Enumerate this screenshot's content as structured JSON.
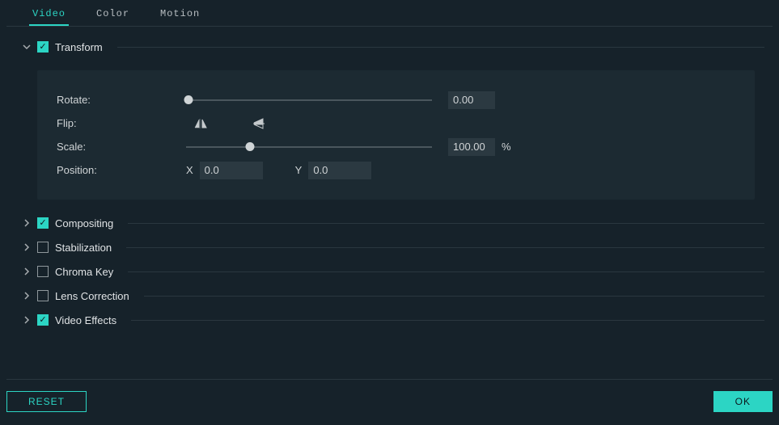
{
  "tabs": {
    "video": "Video",
    "color": "Color",
    "motion": "Motion"
  },
  "sections": {
    "transform": {
      "title": "Transform",
      "checked": true,
      "expanded": true
    },
    "compositing": {
      "title": "Compositing",
      "checked": true,
      "expanded": false
    },
    "stabilization": {
      "title": "Stabilization",
      "checked": false,
      "expanded": false
    },
    "chromakey": {
      "title": "Chroma Key",
      "checked": false,
      "expanded": false
    },
    "lenscorrection": {
      "title": "Lens Correction",
      "checked": false,
      "expanded": false
    },
    "videoeffects": {
      "title": "Video Effects",
      "checked": true,
      "expanded": false
    }
  },
  "transform": {
    "rotate_label": "Rotate:",
    "rotate_value": "0.00",
    "rotate_slider_pct": 1,
    "flip_label": "Flip:",
    "scale_label": "Scale:",
    "scale_value": "100.00",
    "scale_unit": "%",
    "scale_slider_pct": 26,
    "position_label": "Position:",
    "x_label": "X",
    "x_value": "0.0",
    "y_label": "Y",
    "y_value": "0.0"
  },
  "buttons": {
    "reset": "RESET",
    "ok": "OK"
  }
}
